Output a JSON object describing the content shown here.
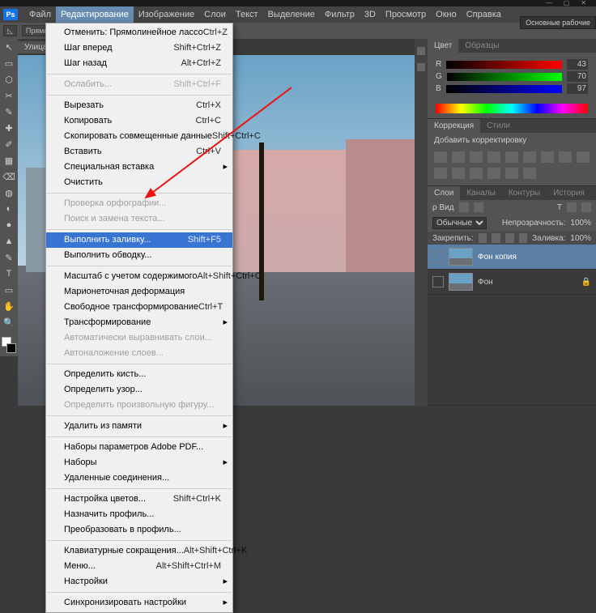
{
  "window_controls": {
    "minimize": "—",
    "maximize": "▢",
    "close": "✕"
  },
  "logo": "Ps",
  "menubar": {
    "items": [
      "Файл",
      "Редактирование",
      "Изображение",
      "Слои",
      "Текст",
      "Выделение",
      "Фильтр",
      "3D",
      "Просмотр",
      "Окно",
      "Справка"
    ],
    "active_index": 1
  },
  "workspace_label": "Основные рабочие",
  "optbar": {
    "lasso_label": "Прямолин. край...",
    "doc_tab": "Улица"
  },
  "dropdown": [
    {
      "label": "Отменить: Прямолинейное лассо",
      "shortcut": "Ctrl+Z"
    },
    {
      "label": "Шаг вперед",
      "shortcut": "Shift+Ctrl+Z"
    },
    {
      "label": "Шаг назад",
      "shortcut": "Alt+Ctrl+Z"
    },
    {
      "sep": true
    },
    {
      "label": "Ослабить...",
      "shortcut": "Shift+Ctrl+F",
      "disabled": true
    },
    {
      "sep": true
    },
    {
      "label": "Вырезать",
      "shortcut": "Ctrl+X"
    },
    {
      "label": "Копировать",
      "shortcut": "Ctrl+C"
    },
    {
      "label": "Скопировать совмещенные данные",
      "shortcut": "Shift+Ctrl+C"
    },
    {
      "label": "Вставить",
      "shortcut": "Ctrl+V"
    },
    {
      "label": "Специальная вставка",
      "shortcut": "",
      "submenu": true
    },
    {
      "label": "Очистить",
      "shortcut": ""
    },
    {
      "sep": true
    },
    {
      "label": "Проверка орфографии...",
      "shortcut": "",
      "disabled": true
    },
    {
      "label": "Поиск и замена текста...",
      "shortcut": "",
      "disabled": true
    },
    {
      "sep": true
    },
    {
      "label": "Выполнить заливку...",
      "shortcut": "Shift+F5",
      "selected": true
    },
    {
      "label": "Выполнить обводку...",
      "shortcut": ""
    },
    {
      "sep": true
    },
    {
      "label": "Масштаб с учетом содержимого",
      "shortcut": "Alt+Shift+Ctrl+C"
    },
    {
      "label": "Марионеточная деформация",
      "shortcut": ""
    },
    {
      "label": "Свободное трансформирование",
      "shortcut": "Ctrl+T"
    },
    {
      "label": "Трансформирование",
      "shortcut": "",
      "submenu": true
    },
    {
      "label": "Автоматически выравнивать слои...",
      "shortcut": "",
      "disabled": true
    },
    {
      "label": "Автоналожение слоев...",
      "shortcut": "",
      "disabled": true
    },
    {
      "sep": true
    },
    {
      "label": "Определить кисть...",
      "shortcut": ""
    },
    {
      "label": "Определить узор...",
      "shortcut": ""
    },
    {
      "label": "Определить произвольную фигуру...",
      "shortcut": "",
      "disabled": true
    },
    {
      "sep": true
    },
    {
      "label": "Удалить из памяти",
      "shortcut": "",
      "submenu": true
    },
    {
      "sep": true
    },
    {
      "label": "Наборы параметров Adobe PDF...",
      "shortcut": ""
    },
    {
      "label": "Наборы",
      "shortcut": "",
      "submenu": true
    },
    {
      "label": "Удаленные соединения...",
      "shortcut": ""
    },
    {
      "sep": true
    },
    {
      "label": "Настройка цветов...",
      "shortcut": "Shift+Ctrl+K"
    },
    {
      "label": "Назначить профиль...",
      "shortcut": ""
    },
    {
      "label": "Преобразовать в профиль...",
      "shortcut": ""
    },
    {
      "sep": true
    },
    {
      "label": "Клавиатурные сокращения...",
      "shortcut": "Alt+Shift+Ctrl+K"
    },
    {
      "label": "Меню...",
      "shortcut": "Alt+Shift+Ctrl+M"
    },
    {
      "label": "Настройки",
      "shortcut": "",
      "submenu": true
    },
    {
      "sep": true
    },
    {
      "label": "Синхронизировать настройки",
      "shortcut": "",
      "submenu": true
    }
  ],
  "tools": [
    "↖",
    "▭",
    "⬡",
    "✂",
    "✎",
    "✚",
    "✐",
    "▦",
    "⌫",
    "◍",
    "◐",
    "●",
    "▲",
    "✎",
    "T",
    "▭",
    "✋",
    "🔍"
  ],
  "color": {
    "tabs": [
      "Цвет",
      "Образцы"
    ],
    "r_label": "R",
    "g_label": "G",
    "b_label": "B",
    "r": 43,
    "g": 70,
    "b": 97
  },
  "adjustments": {
    "tabs": [
      "Коррекция",
      "Стили"
    ],
    "header": "Добавить корректировку"
  },
  "layers": {
    "tabs": [
      "Слои",
      "Каналы",
      "Контуры",
      "История"
    ],
    "filter_label": "ρ Вид",
    "blend_mode": "Обычные",
    "opacity_label": "Непрозрачность:",
    "opacity": "100%",
    "lock_label": "Закрепить:",
    "fill_label": "Заливка:",
    "fill": "100%",
    "items": [
      {
        "name": "Фон копия",
        "selected": true
      },
      {
        "name": "Фон",
        "locked": true
      }
    ]
  }
}
